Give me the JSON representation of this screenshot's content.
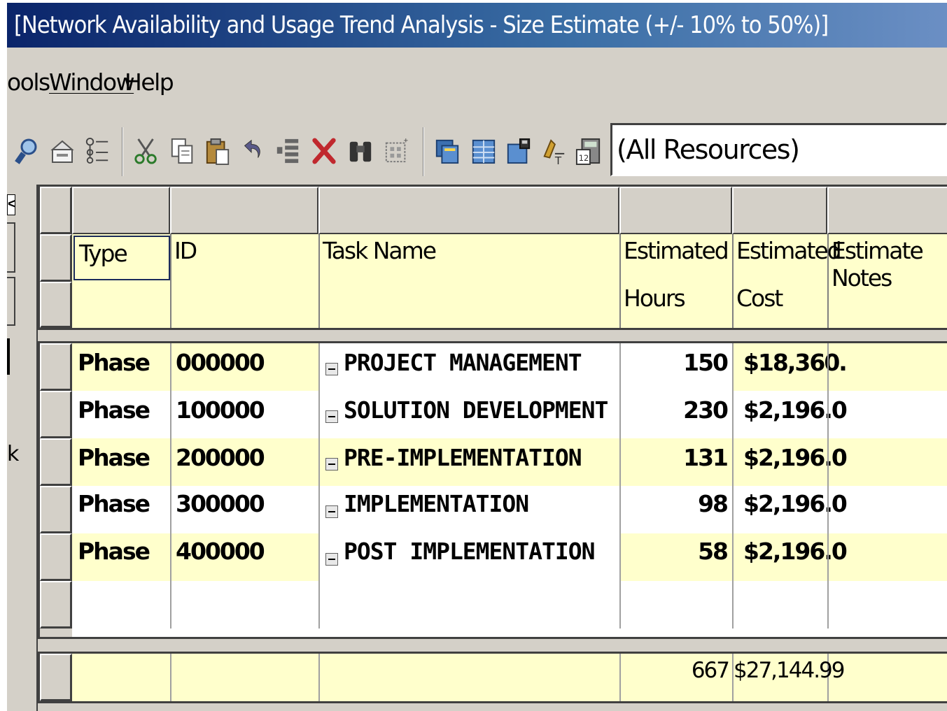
{
  "window": {
    "title": "[Network Availability and Usage Trend Analysis - Size Estimate (+/- 10% to 50%)]"
  },
  "menu": {
    "tools_label": "ools",
    "window_label": "Window",
    "help_label": "Help"
  },
  "toolbar": {
    "resource_filter": "(All Resources)",
    "icons": [
      "find-icon",
      "inbox-icon",
      "outline-icon",
      "cut-icon",
      "copy-icon",
      "paste-icon",
      "undo-icon",
      "indent-icon",
      "delete-icon",
      "binoculars-icon",
      "grid-select-icon",
      "move-icon",
      "table-icon",
      "save-db-icon",
      "sort-icon",
      "calculator-icon"
    ]
  },
  "left_pane": {
    "fragment_top": "<",
    "fragment_mid": "k"
  },
  "grid": {
    "columns": [
      {
        "label": "Type"
      },
      {
        "label": "ID"
      },
      {
        "label": "Task Name"
      },
      {
        "label": "Estimated",
        "label2": "Hours"
      },
      {
        "label": "Estimated",
        "label2": "Cost"
      },
      {
        "label": "Estimate Notes"
      }
    ],
    "rows": [
      {
        "type": "Phase",
        "id": "000000",
        "task": "PROJECT MANAGEMENT",
        "hours": "150",
        "cost": "$18,360.",
        "notes": ""
      },
      {
        "type": "Phase",
        "id": "100000",
        "task": "SOLUTION DEVELOPMENT",
        "hours": "230",
        "cost": "$2,196.0",
        "notes": ""
      },
      {
        "type": "Phase",
        "id": "200000",
        "task": "PRE-IMPLEMENTATION",
        "hours": "131",
        "cost": "$2,196.0",
        "notes": ""
      },
      {
        "type": "Phase",
        "id": "300000",
        "task": "IMPLEMENTATION",
        "hours": "98",
        "cost": "$2,196.0",
        "notes": ""
      },
      {
        "type": "Phase",
        "id": "400000",
        "task": "POST IMPLEMENTATION",
        "hours": "58",
        "cost": "$2,196.0",
        "notes": ""
      }
    ],
    "totals": {
      "hours": "667",
      "cost": "$27,144.99"
    }
  },
  "colors": {
    "title_bar": "#0a246a",
    "chrome": "#d4d0c8",
    "row_highlight": "#ffffcc"
  }
}
